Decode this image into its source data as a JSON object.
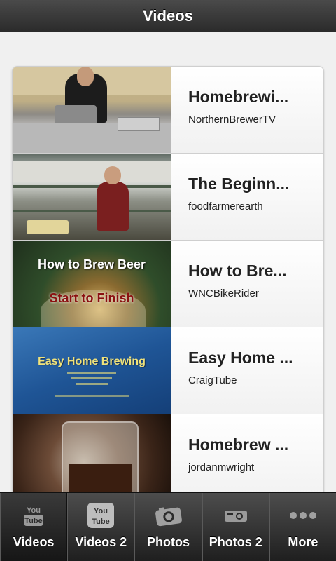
{
  "header": {
    "title": "Videos"
  },
  "videos": [
    {
      "title": "Homebrewi...",
      "channel": "NorthernBrewerTV"
    },
    {
      "title": "The Beginn...",
      "channel": "foodfarmerearth"
    },
    {
      "title": "How to Bre...",
      "channel": "WNCBikeRider",
      "thumb_text": [
        "How to Brew Beer",
        "Start to Finish"
      ]
    },
    {
      "title": "Easy Home ...",
      "channel": "CraigTube",
      "thumb_text": [
        "Easy Home Brewing"
      ]
    },
    {
      "title": "Homebrew ...",
      "channel": "jordanmwright"
    }
  ],
  "tabs": [
    {
      "label": "Videos",
      "icon": "youtube-icon"
    },
    {
      "label": "Videos 2",
      "icon": "youtube-icon"
    },
    {
      "label": "Photos",
      "icon": "camera-icon"
    },
    {
      "label": "Photos 2",
      "icon": "projector-icon"
    },
    {
      "label": "More",
      "icon": "more-dots-icon"
    }
  ],
  "colors": {
    "header_bg": "#2b2b2b",
    "tabbar_bg": "#1f1f1f",
    "text": "#222222"
  }
}
